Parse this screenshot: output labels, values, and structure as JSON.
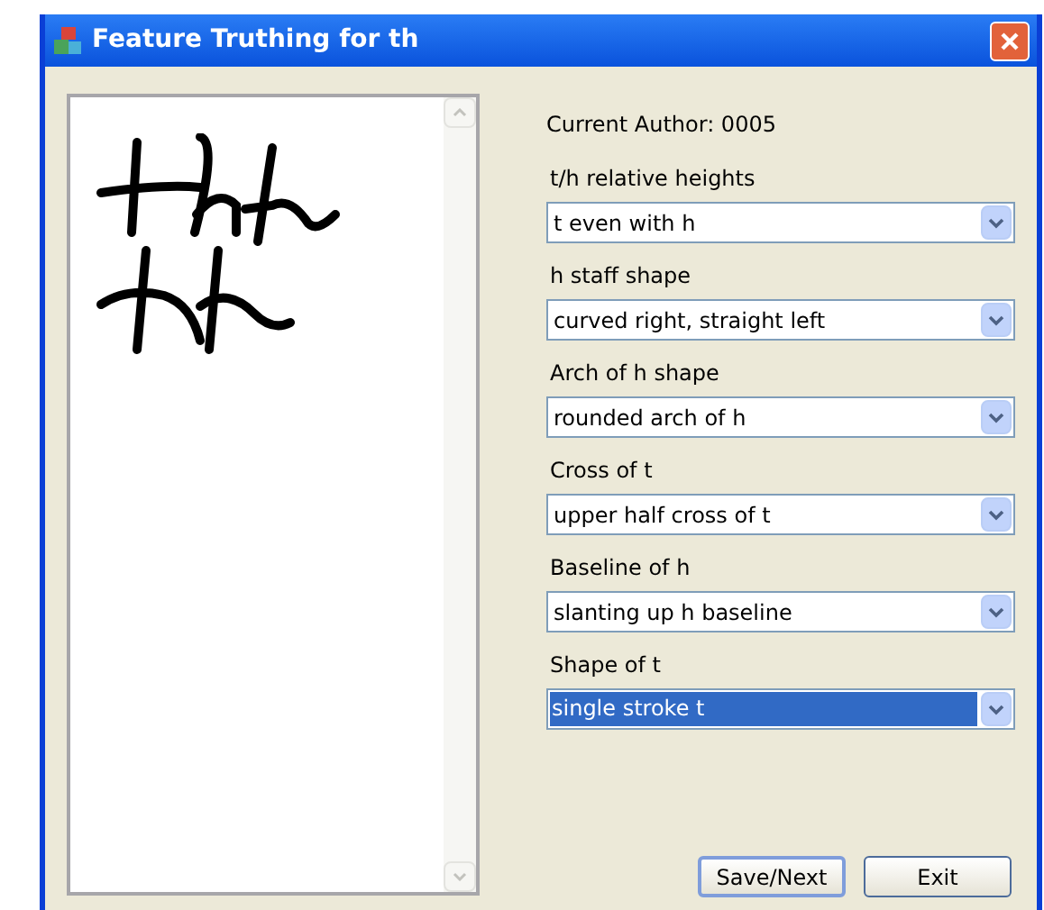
{
  "window": {
    "title": "Feature Truthing for th"
  },
  "author": "Current Author: 0005",
  "fields": [
    {
      "label": "t/h relative heights",
      "value": "t even with h",
      "selected": false
    },
    {
      "label": "h staff shape",
      "value": "curved right, straight left",
      "selected": false
    },
    {
      "label": "Arch of h shape",
      "value": "rounded arch of h",
      "selected": false
    },
    {
      "label": "Cross of t",
      "value": "upper half cross of t",
      "selected": false
    },
    {
      "label": "Baseline of h",
      "value": "slanting up h baseline",
      "selected": false
    },
    {
      "label": "Shape of t",
      "value": "single stroke t",
      "selected": true
    }
  ],
  "buttons": [
    {
      "label": "Save/Next",
      "default": true
    },
    {
      "label": "Exit",
      "default": false
    }
  ]
}
